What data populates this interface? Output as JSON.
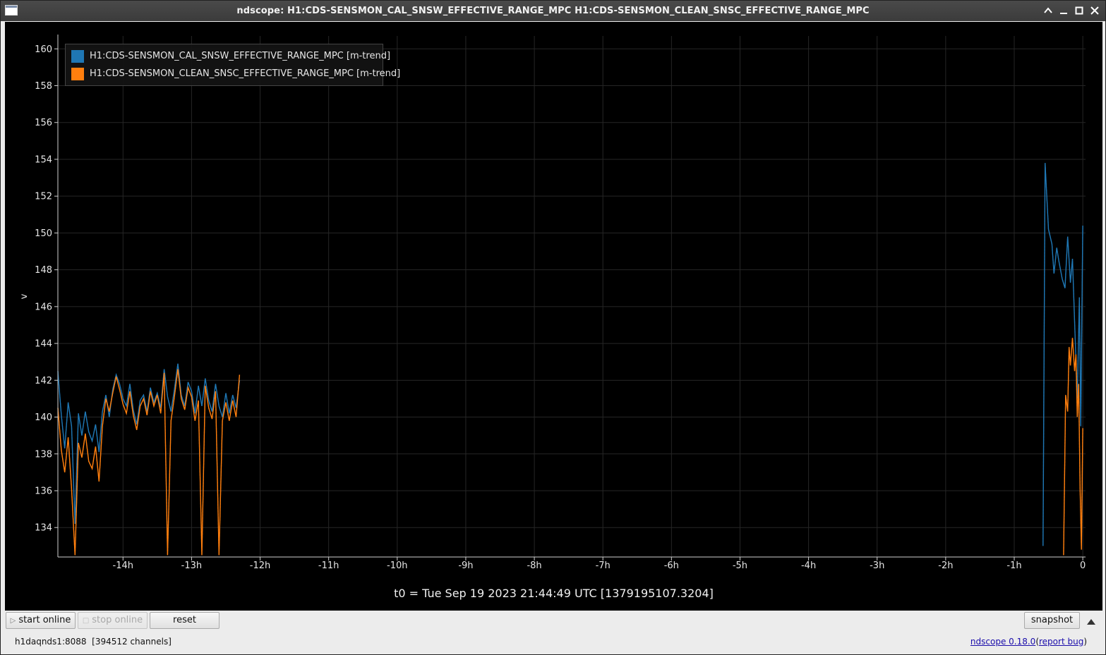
{
  "window": {
    "title": "ndscope: H1:CDS-SENSMON_CAL_SNSW_EFFECTIVE_RANGE_MPC H1:CDS-SENSMON_CLEAN_SNSC_EFFECTIVE_RANGE_MPC",
    "buttons": [
      "minimize-up",
      "minimize",
      "maximize",
      "close"
    ]
  },
  "legend": [
    {
      "label": "H1:CDS-SENSMON_CAL_SNSW_EFFECTIVE_RANGE_MPC [m-trend]",
      "color": "#1f77b4"
    },
    {
      "label": "H1:CDS-SENSMON_CLEAN_SNSC_EFFECTIVE_RANGE_MPC [m-trend]",
      "color": "#ff7f0e"
    }
  ],
  "plot": {
    "t0_label": "t0 = Tue Sep 19 2023 21:44:49 UTC [1379195107.3204]",
    "background": "#000000",
    "grid_color": "#262626",
    "axis_color": "#cfcfcf"
  },
  "chart_data": {
    "type": "line",
    "title": "",
    "xlabel": "",
    "ylabel": "v",
    "xlim": [
      -14.95,
      0.04
    ],
    "ylim": [
      132.4,
      160.7
    ],
    "grid": true,
    "legend_position": "top-left",
    "x_unit": "hours relative to t0",
    "x_ticks": [
      -14,
      -13,
      -12,
      -11,
      -10,
      -9,
      -8,
      -7,
      -6,
      -5,
      -4,
      -3,
      -2,
      -1,
      0
    ],
    "x_tick_labels": [
      "-14h",
      "-13h",
      "-12h",
      "-11h",
      "-10h",
      "-9h",
      "-8h",
      "-7h",
      "-6h",
      "-5h",
      "-4h",
      "-3h",
      "-2h",
      "-1h",
      "0"
    ],
    "y_ticks": [
      134,
      136,
      138,
      140,
      142,
      144,
      146,
      148,
      150,
      152,
      154,
      156,
      158,
      160
    ],
    "y_tick_labels": [
      "134",
      "136",
      "138",
      "140",
      "142",
      "144",
      "146",
      "148",
      "150",
      "152",
      "154",
      "156",
      "158",
      "160"
    ],
    "series": [
      {
        "name": "H1:CDS-SENSMON_CAL_SNSW_EFFECTIVE_RANGE_MPC [m-trend]",
        "color": "#1f77b4",
        "segments": [
          {
            "x": [
              -14.95,
              -14.9,
              -14.85,
              -14.8,
              -14.75,
              -14.7,
              -14.65,
              -14.6,
              -14.55,
              -14.5,
              -14.45,
              -14.4,
              -14.35,
              -14.3,
              -14.25,
              -14.2,
              -14.15,
              -14.1,
              -14.05,
              -14.0,
              -13.95,
              -13.9,
              -13.85,
              -13.8,
              -13.75,
              -13.7,
              -13.65,
              -13.6,
              -13.55,
              -13.5,
              -13.45,
              -13.4,
              -13.35,
              -13.3,
              -13.25,
              -13.2,
              -13.15,
              -13.1,
              -13.05,
              -13.0,
              -12.95,
              -12.9,
              -12.85,
              -12.8,
              -12.75,
              -12.7,
              -12.65,
              -12.6,
              -12.55,
              -12.5,
              -12.45,
              -12.4,
              -12.35,
              -12.3
            ],
            "y": [
              142.5,
              140.1,
              138.3,
              140.8,
              139.5,
              134.2,
              140.2,
              139.0,
              140.3,
              139.2,
              138.7,
              139.6,
              138.1,
              140.3,
              141.2,
              140.0,
              141.5,
              142.3,
              141.8,
              141.0,
              140.6,
              141.8,
              140.4,
              139.6,
              140.9,
              141.2,
              140.3,
              141.6,
              140.8,
              141.3,
              140.5,
              142.6,
              141.1,
              140.3,
              141.5,
              142.9,
              141.2,
              140.6,
              141.9,
              141.4,
              140.2,
              141.7,
              140.6,
              142.1,
              140.9,
              140.3,
              141.8,
              140.6,
              140.0,
              141.3,
              140.2,
              141.2,
              140.5,
              142.0
            ]
          },
          {
            "x": [
              -0.58,
              -0.55,
              -0.5,
              -0.45,
              -0.42,
              -0.38,
              -0.35,
              -0.3,
              -0.26,
              -0.22,
              -0.18,
              -0.15,
              -0.12,
              -0.08,
              -0.05,
              -0.03,
              0.0
            ],
            "y": [
              133.0,
              153.8,
              150.2,
              149.4,
              147.8,
              149.2,
              148.5,
              147.5,
              147.0,
              149.8,
              147.3,
              148.6,
              145.2,
              141.0,
              146.5,
              139.5,
              150.4
            ]
          }
        ]
      },
      {
        "name": "H1:CDS-SENSMON_CLEAN_SNSC_EFFECTIVE_RANGE_MPC [m-trend]",
        "color": "#ff7f0e",
        "segments": [
          {
            "x": [
              -14.95,
              -14.9,
              -14.85,
              -14.8,
              -14.75,
              -14.7,
              -14.65,
              -14.6,
              -14.55,
              -14.5,
              -14.45,
              -14.4,
              -14.35,
              -14.3,
              -14.25,
              -14.2,
              -14.15,
              -14.1,
              -14.05,
              -14.0,
              -13.95,
              -13.9,
              -13.85,
              -13.8,
              -13.75,
              -13.7,
              -13.65,
              -13.6,
              -13.55,
              -13.5,
              -13.45,
              -13.4,
              -13.35,
              -13.3,
              -13.25,
              -13.2,
              -13.15,
              -13.1,
              -13.05,
              -13.0,
              -12.95,
              -12.9,
              -12.85,
              -12.8,
              -12.75,
              -12.7,
              -12.65,
              -12.6,
              -12.55,
              -12.5,
              -12.45,
              -12.4,
              -12.35,
              -12.3
            ],
            "y": [
              140.5,
              138.2,
              137.0,
              138.9,
              136.1,
              132.5,
              138.6,
              137.8,
              139.1,
              137.6,
              137.2,
              138.4,
              136.5,
              139.5,
              141.0,
              140.3,
              141.3,
              142.2,
              141.5,
              140.7,
              140.2,
              141.4,
              140.1,
              139.3,
              140.6,
              141.0,
              140.1,
              141.4,
              140.6,
              141.2,
              140.2,
              142.4,
              132.5,
              139.8,
              141.1,
              142.6,
              141.0,
              140.4,
              141.6,
              141.1,
              139.8,
              140.9,
              132.5,
              141.7,
              140.5,
              139.9,
              141.4,
              132.5,
              139.8,
              140.8,
              139.8,
              140.9,
              140.0,
              142.3
            ]
          },
          {
            "x": [
              -0.28,
              -0.25,
              -0.22,
              -0.2,
              -0.18,
              -0.15,
              -0.12,
              -0.1,
              -0.08,
              -0.06,
              -0.04,
              -0.02,
              0.0
            ],
            "y": [
              132.5,
              141.2,
              140.3,
              143.8,
              142.8,
              144.3,
              142.5,
              143.4,
              140.0,
              141.8,
              136.3,
              132.8,
              139.4
            ]
          }
        ]
      }
    ]
  },
  "toolbar": {
    "start_online": "start online",
    "stop_online": "stop online",
    "reset": "reset",
    "snapshot": "snapshot"
  },
  "status": {
    "connection": "h1daqnds1:8088  [394512 channels]",
    "version_link": "ndscope 0.18.0",
    "report_open": "(",
    "report_link": "report bug",
    "report_close": ")"
  }
}
